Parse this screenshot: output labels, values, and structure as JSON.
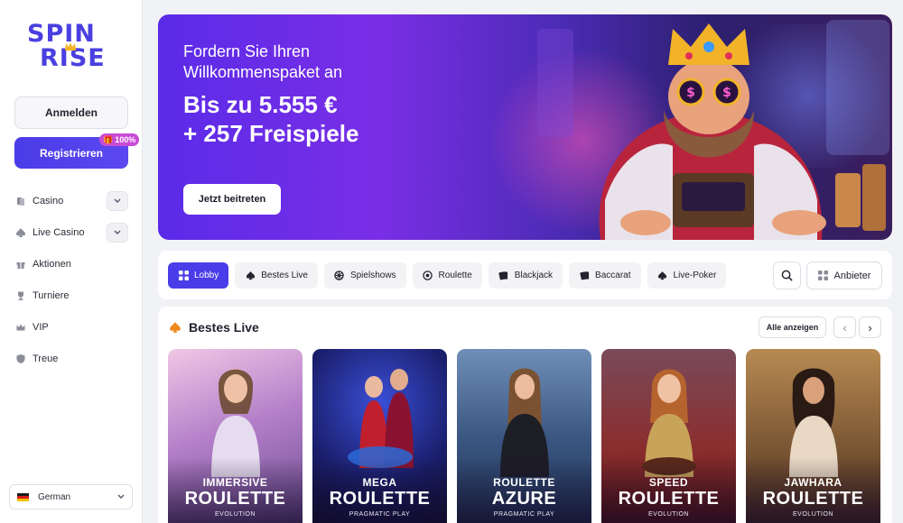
{
  "brand": {
    "logo_line1": "SPIN",
    "logo_line2": "RISE",
    "accent": "#4a3ce8"
  },
  "auth": {
    "login_label": "Anmelden",
    "register_label": "Registrieren",
    "register_badge": "100%"
  },
  "sidebar": {
    "items": [
      {
        "label": "Casino",
        "icon": "cards-icon",
        "expandable": true
      },
      {
        "label": "Live Casino",
        "icon": "spade-icon",
        "expandable": true
      },
      {
        "label": "Aktionen",
        "icon": "gift-icon",
        "expandable": false
      },
      {
        "label": "Turniere",
        "icon": "trophy-icon",
        "expandable": false
      },
      {
        "label": "VIP",
        "icon": "crown-icon",
        "expandable": false
      },
      {
        "label": "Treue",
        "icon": "shield-icon",
        "expandable": false
      }
    ],
    "language": "German"
  },
  "hero": {
    "headline": "Fordern Sie Ihren Willkommenspaket an",
    "offer_line1": "Bis zu 5.555 €",
    "offer_line2": "+ 257 Freispiele",
    "cta_label": "Jetzt beitreten"
  },
  "categories": {
    "tabs": [
      {
        "label": "Lobby",
        "icon": "grid-icon",
        "active": true
      },
      {
        "label": "Bestes Live",
        "icon": "spade-icon",
        "active": false
      },
      {
        "label": "Spielshows",
        "icon": "wheel-icon",
        "active": false
      },
      {
        "label": "Roulette",
        "icon": "roulette-icon",
        "active": false
      },
      {
        "label": "Blackjack",
        "icon": "blackjack-icon",
        "active": false
      },
      {
        "label": "Baccarat",
        "icon": "baccarat-icon",
        "active": false
      },
      {
        "label": "Live-Poker",
        "icon": "poker-icon",
        "active": false
      }
    ],
    "provider_label": "Anbieter"
  },
  "section": {
    "title": "Bestes Live",
    "see_all_label": "Alle anzeigen",
    "games": [
      {
        "line1": "IMMERSIVE",
        "line2": "ROULETTE",
        "provider": "EVOLUTION"
      },
      {
        "line1": "MEGA",
        "line2": "ROULETTE",
        "provider": "PRAGMATIC PLAY"
      },
      {
        "line1": "ROULETTE",
        "line2": "AZURE",
        "provider": "PRAGMATIC PLAY"
      },
      {
        "line1": "SPEED",
        "line2": "ROULETTE",
        "provider": "EVOLUTION"
      },
      {
        "line1": "JAWHARA",
        "line2": "ROULETTE",
        "provider": "EVOLUTION"
      }
    ]
  }
}
